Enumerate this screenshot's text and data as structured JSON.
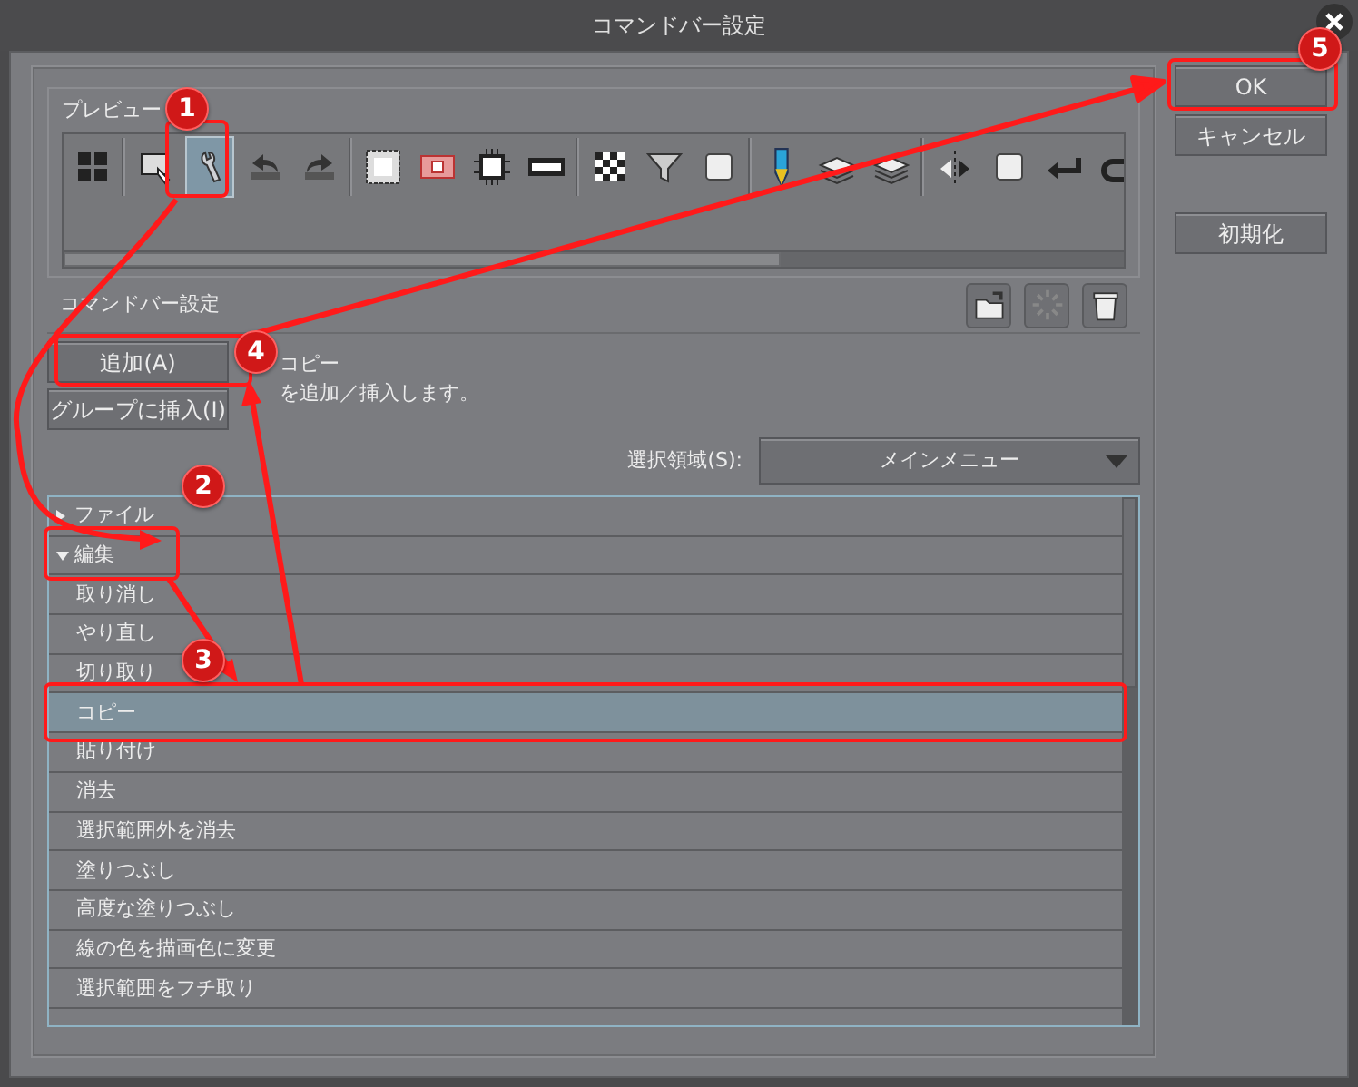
{
  "window": {
    "title": "コマンドバー設定"
  },
  "preview": {
    "label": "プレビュー",
    "toolbar": [
      {
        "kind": "grid",
        "selected": false
      },
      {
        "kind": "separator"
      },
      {
        "kind": "picture",
        "selected": false
      },
      {
        "kind": "wrench",
        "selected": true
      },
      {
        "kind": "undo",
        "selected": false
      },
      {
        "kind": "redo",
        "selected": false
      },
      {
        "kind": "separator"
      },
      {
        "kind": "selection",
        "selected": false
      },
      {
        "kind": "frame",
        "selected": false
      },
      {
        "kind": "chip",
        "selected": false
      },
      {
        "kind": "film",
        "selected": false
      },
      {
        "kind": "separator"
      },
      {
        "kind": "checker",
        "selected": false
      },
      {
        "kind": "funnel",
        "selected": false
      },
      {
        "kind": "square",
        "selected": false
      },
      {
        "kind": "separator"
      },
      {
        "kind": "pencil",
        "selected": false
      },
      {
        "kind": "layers",
        "selected": false
      },
      {
        "kind": "layers",
        "selected": false
      },
      {
        "kind": "separator"
      },
      {
        "kind": "flip",
        "selected": false
      },
      {
        "kind": "square",
        "selected": false
      },
      {
        "kind": "return",
        "selected": false
      },
      {
        "kind": "curve",
        "selected": false
      }
    ]
  },
  "commandbar_section": {
    "label": "コマンドバー設定"
  },
  "add_button": "追加(A)",
  "insert_group_button": "グループに挿入(I)",
  "description": [
    "コピー",
    "を追加／挿入します。"
  ],
  "selection_area": {
    "label": "選択領域(S):",
    "value": "メインメニュー"
  },
  "tree": [
    {
      "label": "ファイル",
      "expanded": false,
      "selected": false
    },
    {
      "label": "編集",
      "expanded": true,
      "selected": false,
      "children": [
        {
          "label": "取り消し",
          "selected": false
        },
        {
          "label": "やり直し",
          "selected": false
        },
        {
          "label": "切り取り",
          "selected": false
        },
        {
          "label": "コピー",
          "selected": true
        },
        {
          "label": "貼り付け",
          "selected": false
        },
        {
          "label": "消去",
          "selected": false
        },
        {
          "label": "選択範囲外を消去",
          "selected": false
        },
        {
          "label": "塗りつぶし",
          "selected": false
        },
        {
          "label": "高度な塗りつぶし",
          "selected": false
        },
        {
          "label": "線の色を描画色に変更",
          "selected": false
        },
        {
          "label": "選択範囲をフチ取り",
          "selected": false
        }
      ]
    }
  ],
  "buttons": [
    "OK",
    "キャンセル",
    "初期化"
  ],
  "annotations": {
    "steps": [
      "1",
      "2",
      "3",
      "4",
      "5"
    ]
  }
}
